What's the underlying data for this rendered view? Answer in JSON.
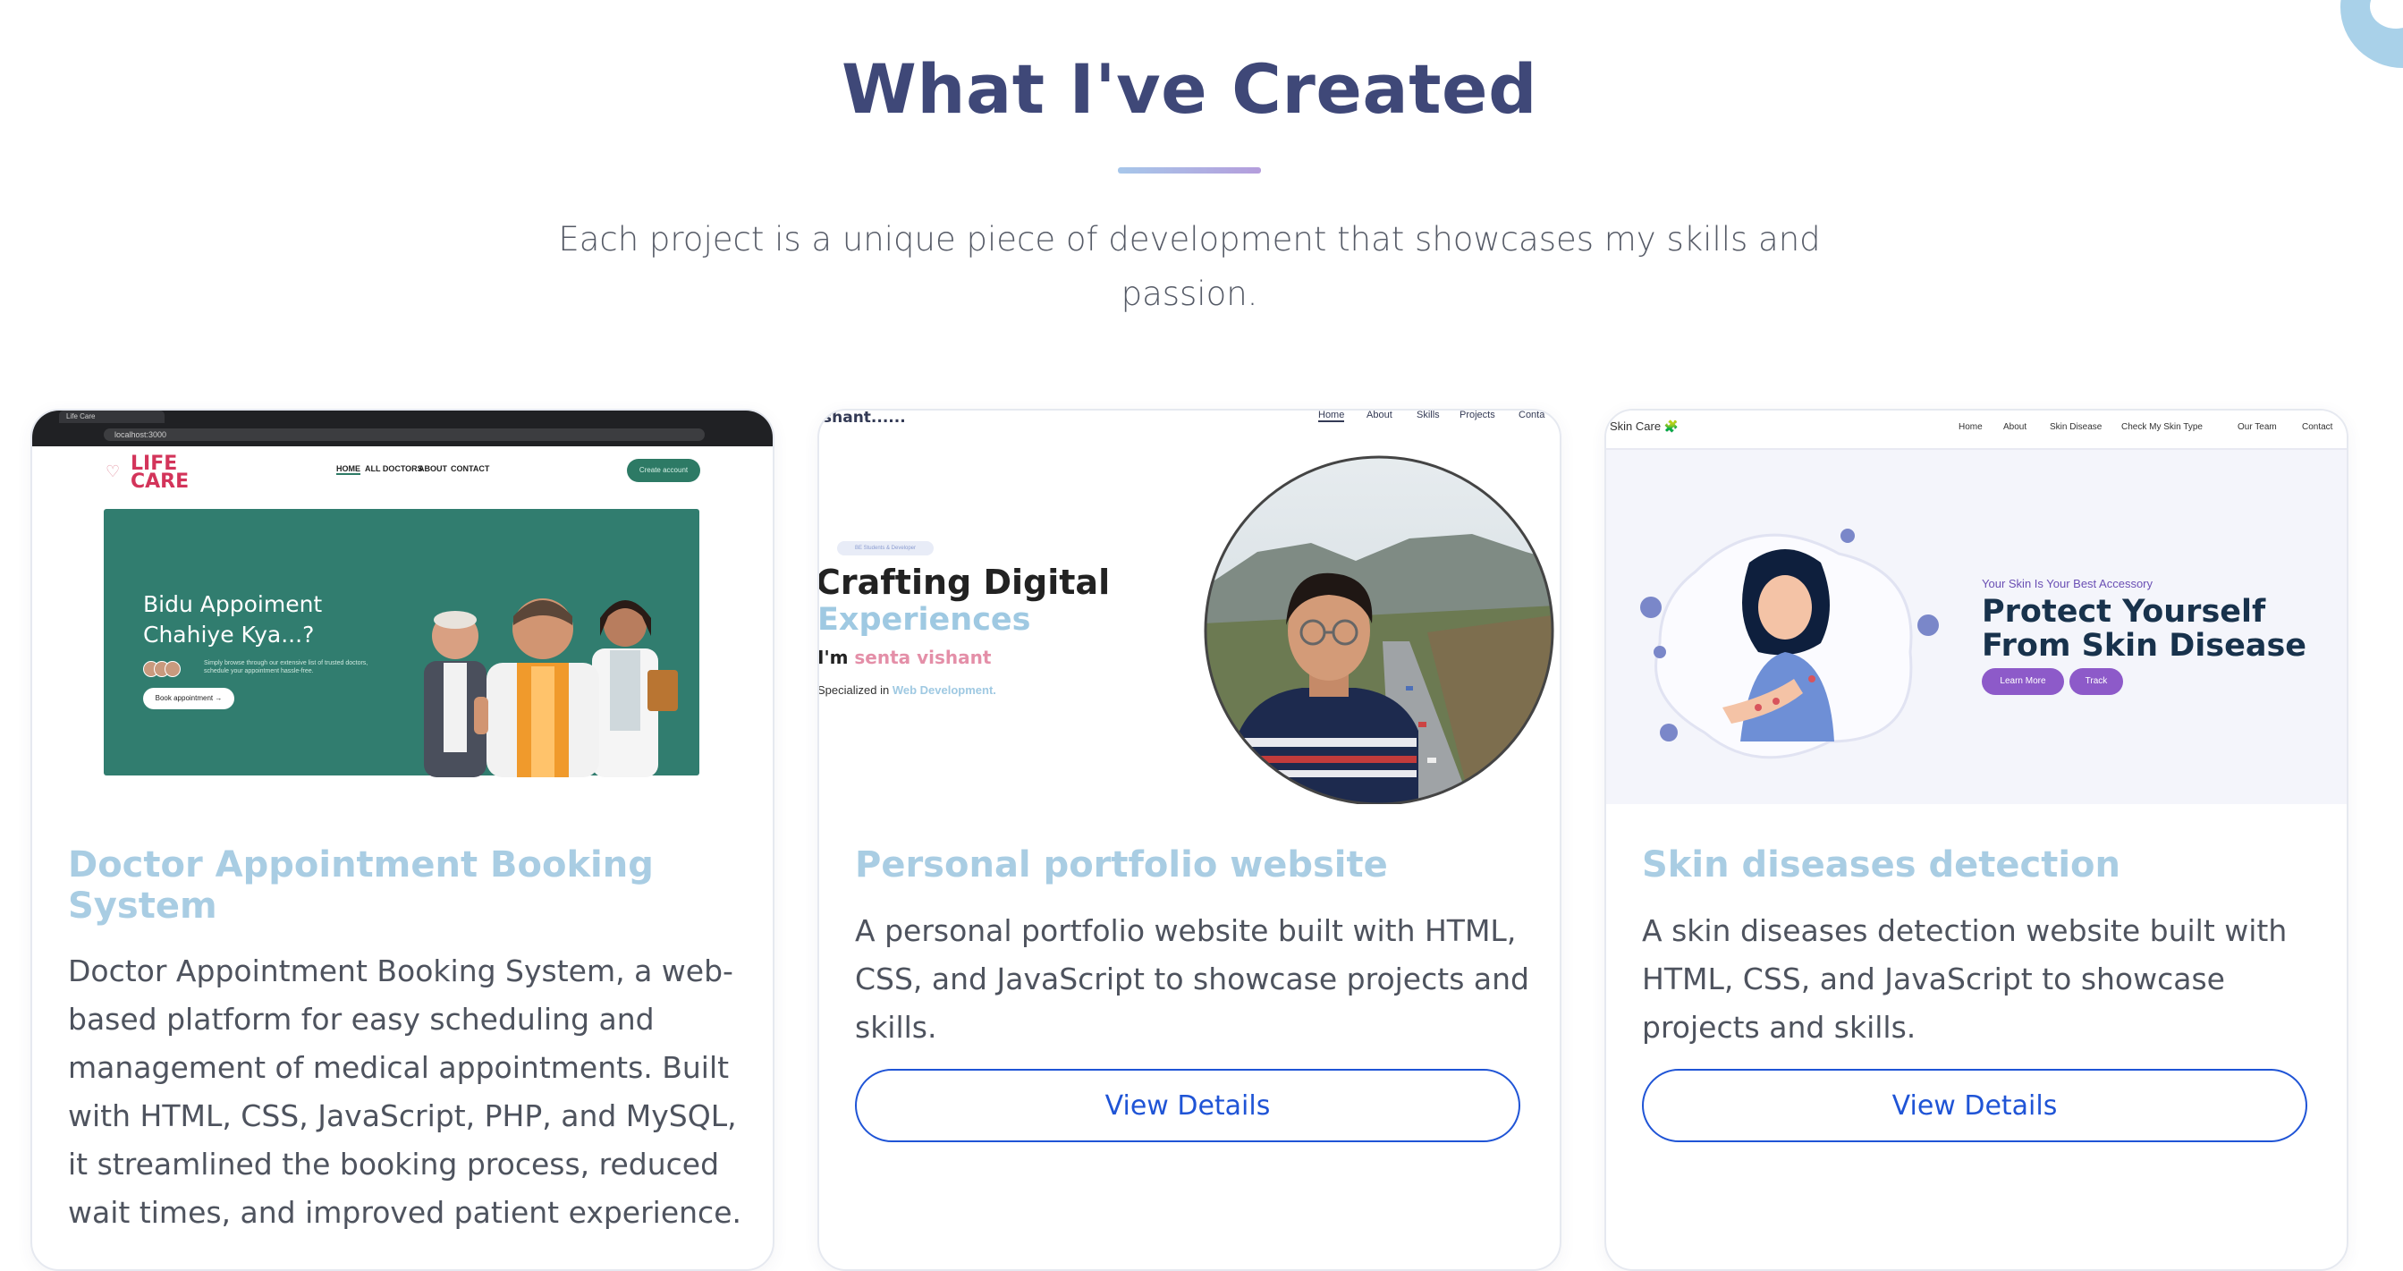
{
  "section": {
    "title": "What I've Created",
    "subtitle": "Each project is a unique piece of development that showcases my skills and passion."
  },
  "projects": [
    {
      "title": "Doctor Appointment Booking System",
      "description": "Doctor Appointment Booking System, a web-based platform for easy scheduling and management of medical appointments. Built with HTML, CSS, JavaScript, PHP, and MySQL, it streamlined the booking process, reduced wait times, and improved patient experience.",
      "preview": {
        "browser_tab": "Life Care",
        "address": "localhost:3000",
        "logo_line1": "LIFE",
        "logo_line2": "CARE",
        "menu": [
          "HOME",
          "ALL DOCTORS",
          "ABOUT",
          "CONTACT"
        ],
        "login_button": "Create account",
        "hero_title": "Bidu Appoiment Chahiye Kya...?",
        "hero_small": "Simply browse through our extensive list of trusted doctors, schedule your appointment hassle-free.",
        "book_button": "Book appointment →"
      }
    },
    {
      "title": "Personal portfolio website",
      "description": "A personal portfolio website built with HTML, CSS, and JavaScript to showcase projects and skills.",
      "button": "View Details",
      "preview": {
        "logo": "shant......",
        "menu": [
          "Home",
          "About",
          "Skills",
          "Projects",
          "Conta"
        ],
        "tag": "BE Students & Developer",
        "headline_1": "Crafting Digital",
        "headline_2": "Experiences",
        "intro_prefix": "I'm",
        "intro_name": "senta vishant",
        "spec_prefix": "Specialized in",
        "spec_value": "Web Development."
      }
    },
    {
      "title": "Skin diseases detection",
      "description": "A skin diseases detection website built with HTML, CSS, and JavaScript to showcase projects and skills.",
      "button": "View Details",
      "preview": {
        "brand": "Skin Care 🧩",
        "menu": [
          "Home",
          "About",
          "Skin Disease",
          "Check My Skin Type",
          "Our Team",
          "Contact"
        ],
        "tagline": "Your Skin Is Your Best Accessory",
        "headline": "Protect Yourself From Skin Disease",
        "learn_button": "Learn More",
        "track_button": "Track"
      }
    }
  ],
  "colors": {
    "title": "#3f4878",
    "card_title": "#a9cde3",
    "button_border": "#1f54d6",
    "lifecare_green": "#317d6f",
    "skincare_purple": "#8d5ac9"
  }
}
